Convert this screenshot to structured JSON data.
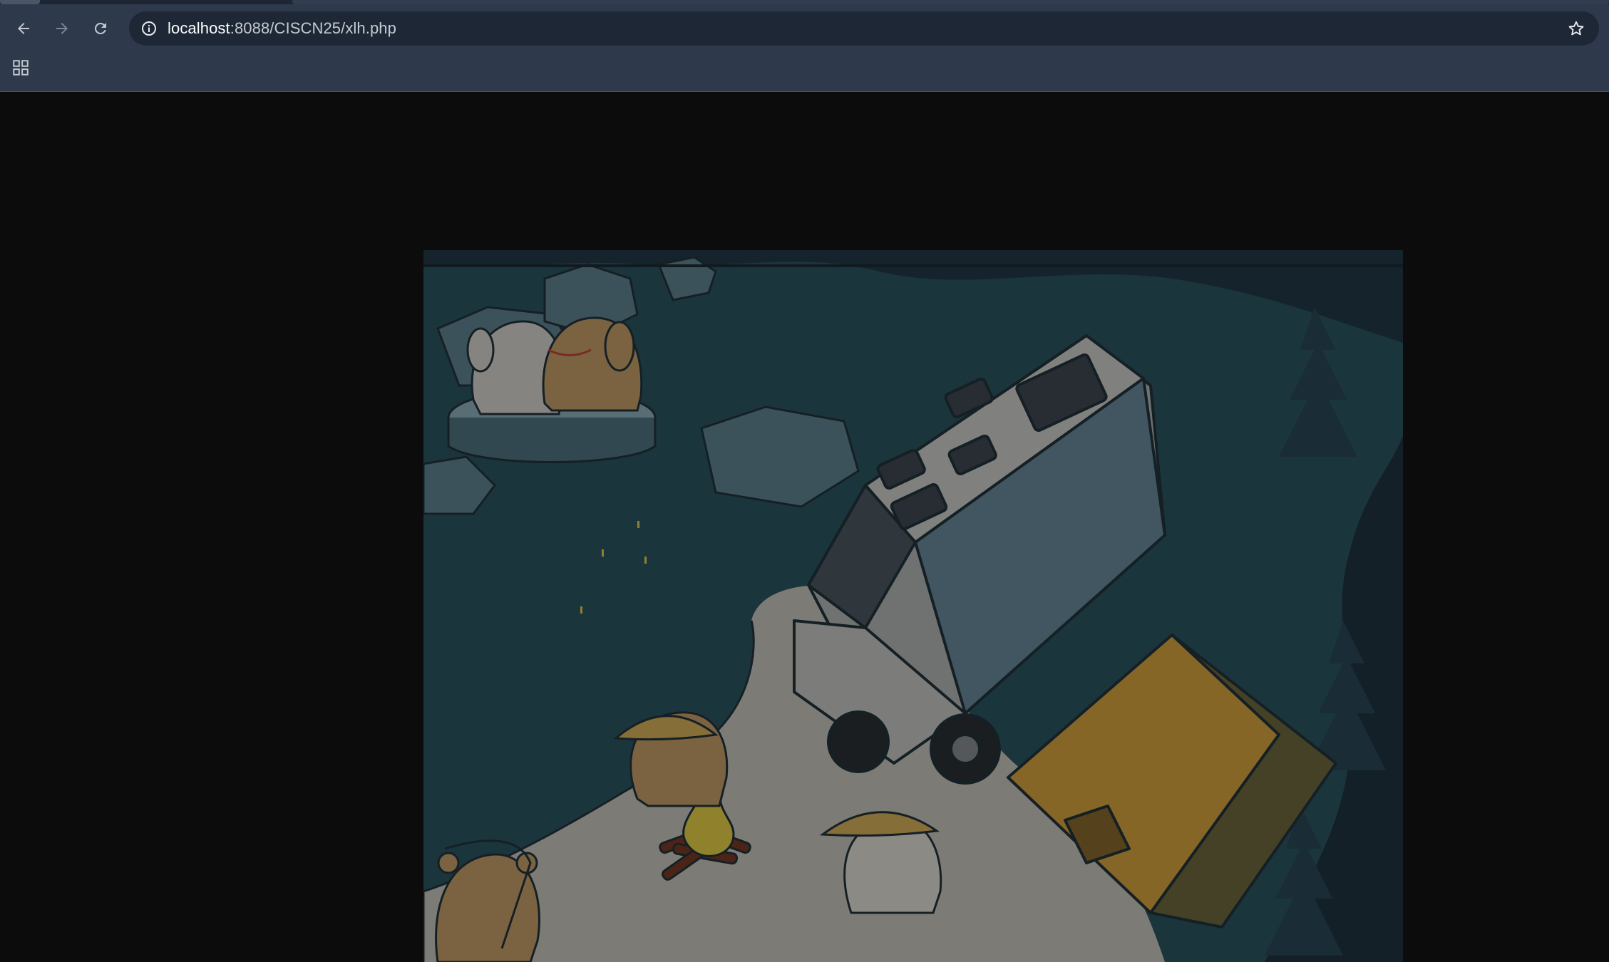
{
  "browser": {
    "address_bar": {
      "host": "localhost",
      "path": ":8088/CISCN25/xlh.php"
    },
    "nav": {
      "back_icon": "arrow-left-icon",
      "forward_icon": "arrow-right-icon",
      "reload_icon": "reload-icon"
    },
    "site_info_icon": "info-circle-icon",
    "bookmark_icon": "star-outline-icon",
    "apps_icon": "apps-grid-icon"
  },
  "page": {
    "background": "#0c0c0c",
    "image": {
      "subject": "camping scene illustration with camper van, tent, campfire and cartoon dogs",
      "dimmed": true
    }
  },
  "colors": {
    "toolbar": "#2e3a4c",
    "omnibox": "#1d2736",
    "icon": "#c4c9d1",
    "icon_disabled": "#7c8593",
    "page_bg": "#0c0c0c"
  }
}
